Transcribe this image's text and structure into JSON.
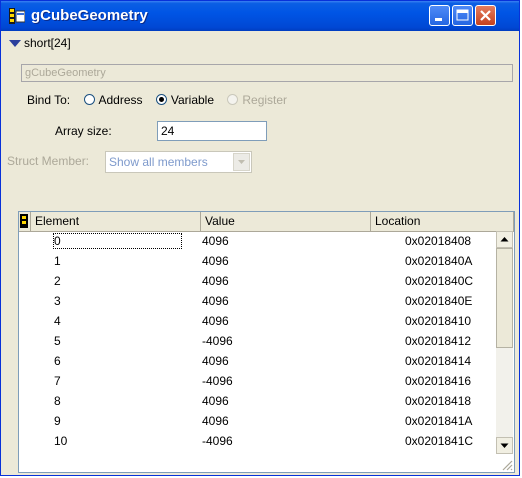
{
  "window": {
    "title": "gCubeGeometry"
  },
  "tree": {
    "node_label": "short[24]"
  },
  "expression": {
    "value": "gCubeGeometry"
  },
  "bind": {
    "label": "Bind To:",
    "options": [
      {
        "label": "Address",
        "selected": false,
        "enabled": true
      },
      {
        "label": "Variable",
        "selected": true,
        "enabled": true
      },
      {
        "label": "Register",
        "selected": false,
        "enabled": false
      }
    ]
  },
  "array": {
    "label": "Array size:",
    "value": "24"
  },
  "struct": {
    "label": "Struct Member:",
    "value": "Show all members"
  },
  "table": {
    "columns": [
      "Element",
      "Value",
      "Location"
    ],
    "rows": [
      {
        "element": "0",
        "value": "4096",
        "location": "0x02018408"
      },
      {
        "element": "1",
        "value": "4096",
        "location": "0x0201840A"
      },
      {
        "element": "2",
        "value": "4096",
        "location": "0x0201840C"
      },
      {
        "element": "3",
        "value": "4096",
        "location": "0x0201840E"
      },
      {
        "element": "4",
        "value": "4096",
        "location": "0x02018410"
      },
      {
        "element": "5",
        "value": "-4096",
        "location": "0x02018412"
      },
      {
        "element": "6",
        "value": "4096",
        "location": "0x02018414"
      },
      {
        "element": "7",
        "value": "-4096",
        "location": "0x02018416"
      },
      {
        "element": "8",
        "value": "4096",
        "location": "0x02018418"
      },
      {
        "element": "9",
        "value": "4096",
        "location": "0x0201841A"
      },
      {
        "element": "10",
        "value": "-4096",
        "location": "0x0201841C"
      }
    ]
  },
  "colors": {
    "titlebar": "#0055e5",
    "face": "#ece9d8",
    "disabled_text": "#aca899"
  },
  "icons": [
    "window-icon",
    "minimize-icon",
    "maximize-icon",
    "close-icon",
    "collapse-triangle-icon",
    "pin-icon",
    "dropdown-arrow-icon",
    "scroll-up-icon",
    "scroll-down-icon",
    "resize-grip-icon"
  ]
}
